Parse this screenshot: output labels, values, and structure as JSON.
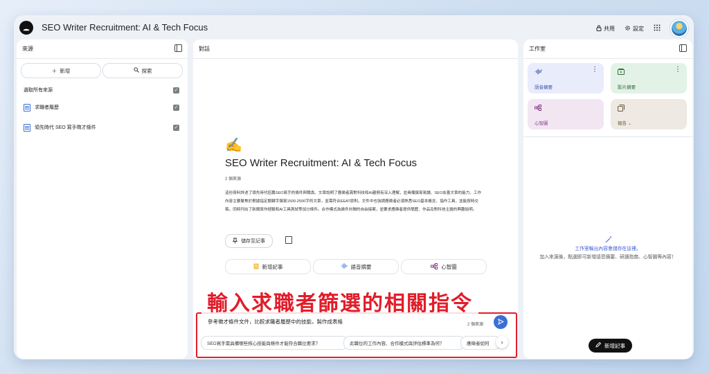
{
  "app": {
    "title": "SEO Writer Recruitment: AI & Tech Focus"
  },
  "topbar": {
    "share_label": "共用",
    "settings_label": "設定"
  },
  "sources": {
    "header": "來源",
    "add_label": "新增",
    "explore_label": "探索",
    "select_all_label": "選取所有來源",
    "items": [
      {
        "label": "求職者履歷"
      },
      {
        "label": "領先時代 SEO 寫手徵才條件"
      }
    ]
  },
  "chat": {
    "header": "對話",
    "emoji": "✍️",
    "title": "SEO Writer Recruitment: AI & Tech Focus",
    "source_count": "2 個來源",
    "description": "這份資料詳述了領先時代招募SEO寫手的條件與職責。文章說明了應徵者需對科技和AI趨勢有深入理解，並具備撰寫易讀、SEO友善文章的能力。工作內容主要聚焦於根據指定關鍵字撰寫1500-2500字的文章，並需符合EEAT原則。文件中也強調應徵者必須熟悉SEO基本概念、協作工具，並能按時交稿，同時列出了新聞寫作經驗和AI工具測試等加分條件。合作模式為論件計酬的自由接案，並要求應徵者提供簡歷、作品及對科技主題的興趣說明。",
    "save_note_label": "儲存至記事",
    "actions": [
      {
        "label": "新增記事"
      },
      {
        "label": "語音摘要"
      },
      {
        "label": "心智圖"
      }
    ],
    "overlay_text": "輸入求職者篩選的相關指令",
    "input_text": "參考徵才條件文件，比較求職者履歷中的技能，製作成表格",
    "input_source_count": "2 個來源",
    "suggestions": [
      {
        "label": "SEO寫手需具備哪些核心技能與條件才能符合職位要求？"
      },
      {
        "label": "此職位的工作內容、合作模式與評估標準為何？"
      },
      {
        "label": "應徵者如何"
      }
    ]
  },
  "studio": {
    "header": "工作室",
    "cards": [
      {
        "label": "語音摘要",
        "icon": "audio-wave-icon",
        "color": "#e9ecfb",
        "text_color": "#3b4fa8"
      },
      {
        "label": "影片摘要",
        "icon": "video-icon",
        "color": "#e3f2e6",
        "text_color": "#2f6b3c"
      },
      {
        "label": "心智圖",
        "icon": "mindmap-icon",
        "color": "#f2e6f2",
        "text_color": "#8a3c8a"
      },
      {
        "label": "報告",
        "icon": "report-icon",
        "color": "#efe9e3",
        "text_color": "#6b5a3c"
      }
    ],
    "empty_title": "工作室輸出內容會儲存在這裡。",
    "empty_desc": "加入來源後，點選即可新增語音摘要、研讀指南、心智圖等內容！",
    "add_note_label": "新增記事"
  },
  "colors": {
    "accent": "#3b6fd6",
    "highlight": "#e11d2a"
  }
}
